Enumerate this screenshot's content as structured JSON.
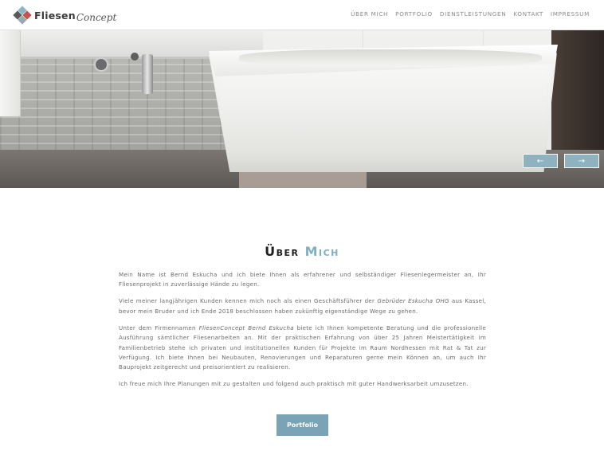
{
  "brand": {
    "name": "Fliesen",
    "script": "Concept"
  },
  "nav": {
    "items": [
      {
        "label": "Über mich"
      },
      {
        "label": "Portfolio"
      },
      {
        "label": "Dienstleistungen"
      },
      {
        "label": "Kontakt"
      },
      {
        "label": "Impressum"
      }
    ]
  },
  "slider": {
    "prev_icon": "arrow-left-icon",
    "next_icon": "arrow-right-icon",
    "prev_glyph": "←",
    "next_glyph": "→"
  },
  "about": {
    "title_part1": "Über",
    "title_part2": "Mich",
    "p1": "Mein Name ist Bernd Eskucha und ich biete Ihnen als erfahrener und selbständiger Fliesenlegermeister an, Ihr Fliesenprojekt in zuverlässige Hände zu legen.",
    "p2_a": "Viele meiner langjährigen Kunden kennen mich noch als einen Geschäftsführer der ",
    "p2_em": "Gebrüder Eskucha OHG",
    "p2_b": " aus Kassel, bevor mein Bruder und ich Ende 2018 beschlossen haben zukünftig eigenständige Wege zu gehen.",
    "p3_a": "Unter dem Firmennamen ",
    "p3_em": "FliesenConcept Bernd Eskucha",
    "p3_b": " biete ich Ihnen kompetente Beratung und die professionelle Ausführung sämtlicher Fliesenarbeiten an. Mit der praktischen Erfahrung von über 25 Jahren Meistertätigkeit im Familienbetrieb stehe ich privaten und institutionellen Kunden für Projekte im Raum Nordhessen mit Rat & Tat zur Verfügung. Ich biete Ihnen bei Neubauten, Renovierungen und Reparaturen gerne mein Können an, um auch Ihr Bauprojekt zeitgerecht und preisorientiert zu realisieren.",
    "p4": "Ich freue mich Ihre Planungen mit zu gestalten und folgend auch praktisch mit guter Handwerksarbeit umzusetzen.",
    "cta_label": "Portfolio"
  },
  "colors": {
    "accent": "#7aa4b5",
    "title_accent": "#7fb0c2",
    "text": "#6b6b6b"
  }
}
